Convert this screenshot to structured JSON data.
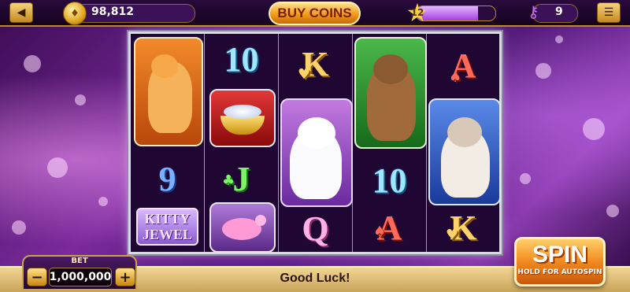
{
  "top": {
    "back_icon": "back-arrow-icon",
    "coins": "98,812",
    "buy_coins": "BUY COINS",
    "level": "12",
    "level_progress_percent": 78,
    "keys": "9",
    "menu_icon": "hamburger-menu-icon"
  },
  "reels": {
    "col1": {
      "mid": "9",
      "logo_line1": "KITTY",
      "logo_line2": "JEWEL"
    },
    "col2": {
      "top": "10",
      "mid": "J"
    },
    "col3": {
      "top": "K",
      "bottom": "Q"
    },
    "col4": {
      "mid": "10",
      "bottom": "A"
    },
    "col5": {
      "top": "A",
      "bottom": "K"
    }
  },
  "bottom": {
    "bet_label": "BET",
    "bet_value": "1,000,000",
    "minus": "−",
    "plus": "+",
    "status": "Good Luck!",
    "spin": "SPIN",
    "spin_sub": "HOLD FOR AUTOSPIN"
  },
  "colors": {
    "accent_gold": "#f09a1c",
    "frame": "#d9d9e6",
    "background": "#4b1570"
  }
}
